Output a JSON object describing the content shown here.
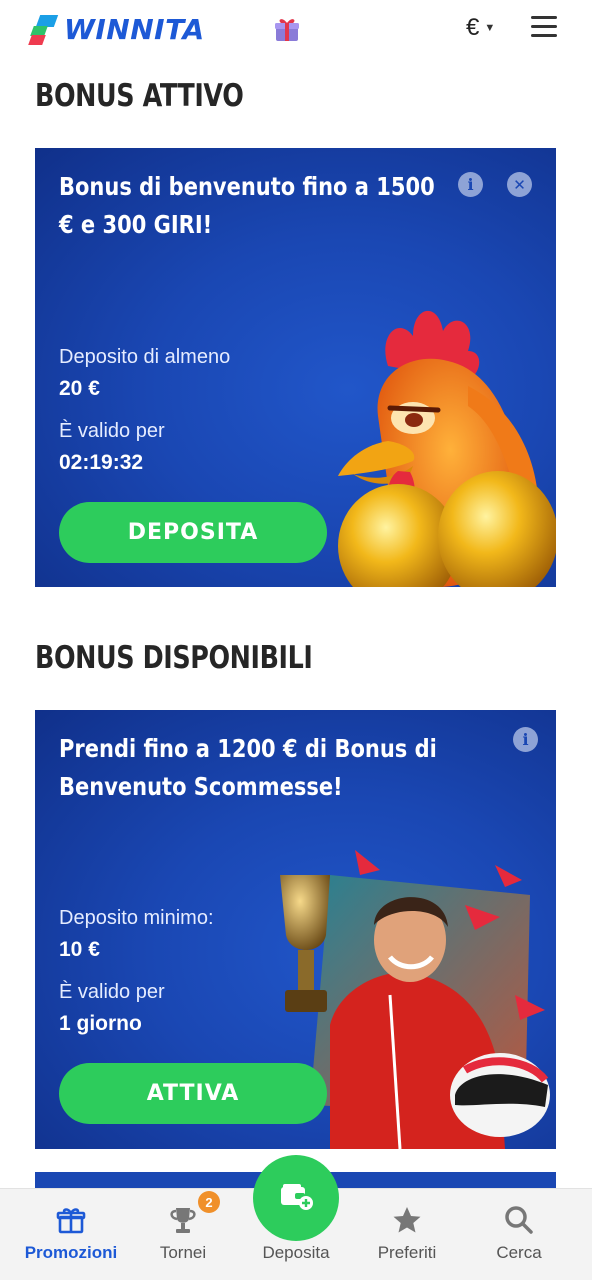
{
  "header": {
    "logo_text": "WINNITA",
    "currency": "€",
    "icons": [
      "gift-icon",
      "chevron-down-icon",
      "hamburger-menu-icon"
    ]
  },
  "active_section": {
    "title": "BONUS ATTIVO",
    "card": {
      "title": "Bonus di benvenuto fino a 1500 € e 300 GIRI!",
      "deposit_label": "Deposito di almeno",
      "deposit_value": "20 €",
      "validity_label": "È valido per",
      "validity_value": "02:19:32",
      "button_label": "DEPOSITA",
      "icons": [
        "info-icon",
        "close-icon"
      ]
    }
  },
  "available_section": {
    "title": "BONUS DISPONIBILI",
    "cards": [
      {
        "title": "Prendi fino a 1200 € di Bonus di Benvenuto Scommesse!",
        "deposit_label": "Deposito minimo:",
        "deposit_value": "10 €",
        "validity_label": "È valido per",
        "validity_value": "1 giorno",
        "button_label": "ATTIVA",
        "icons": [
          "info-icon"
        ]
      }
    ]
  },
  "bottom_nav": {
    "items": [
      {
        "label": "Promozioni",
        "icon": "gift-icon",
        "active": true
      },
      {
        "label": "Tornei",
        "icon": "trophy-icon",
        "badge": "2"
      },
      {
        "label": "Deposita",
        "icon": "wallet-plus-icon"
      },
      {
        "label": "Preferiti",
        "icon": "star-icon"
      },
      {
        "label": "Cerca",
        "icon": "search-icon"
      }
    ]
  },
  "colors": {
    "brand_blue": "#1d59d6",
    "card_blue": "#1a47b3",
    "button_green": "#2dcc5c",
    "badge_orange": "#f0902a"
  }
}
